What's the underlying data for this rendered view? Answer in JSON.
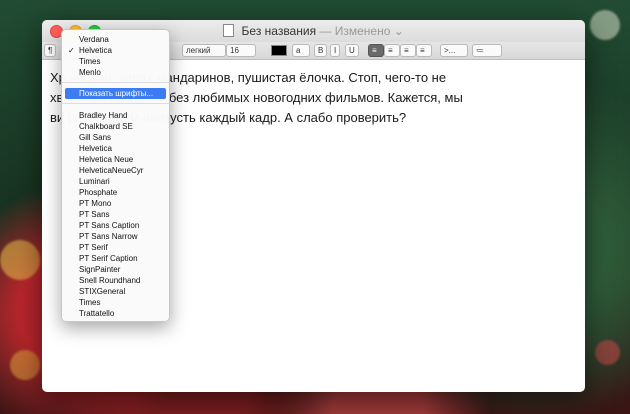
{
  "window": {
    "title": "Без названия",
    "title_status": "— Изменено",
    "title_chevron": "⌄"
  },
  "toolbar": {
    "paragraph": "¶",
    "font_style": "легкий",
    "size": "16",
    "bold": "B",
    "italic": "I",
    "underline": "U",
    "spacing": ">...",
    "list": "≔"
  },
  "document": {
    "line1": "Хр                      ногами, запах мандаринов, пушистая ёлочка. Стоп, чего-то не",
    "line2": "хв                  кой же праздник без любимых новогодних фильмов. Кажется, мы",
    "line3": "ви                  раз и знаем наизусть каждый кадр. А слабо проверить?"
  },
  "font_menu": {
    "recent": [
      "Verdana",
      "Helvetica",
      "Times",
      "Menlo"
    ],
    "checked_index": 1,
    "show_fonts": "Показать шрифты...",
    "fonts": [
      "Bradley Hand",
      "Chalkboard SE",
      "Gill Sans",
      "Helvetica",
      "Helvetica Neue",
      "HelveticaNeueCyr",
      "Luminari",
      "Phosphate",
      "PT Mono",
      "PT Sans",
      "PT Sans Caption",
      "PT Sans Narrow",
      "PT Serif",
      "PT Serif Caption",
      "SignPainter",
      "Snell Roundhand",
      "STIXGeneral",
      "Times",
      "Trattatello"
    ],
    "checkmark": "✓"
  }
}
